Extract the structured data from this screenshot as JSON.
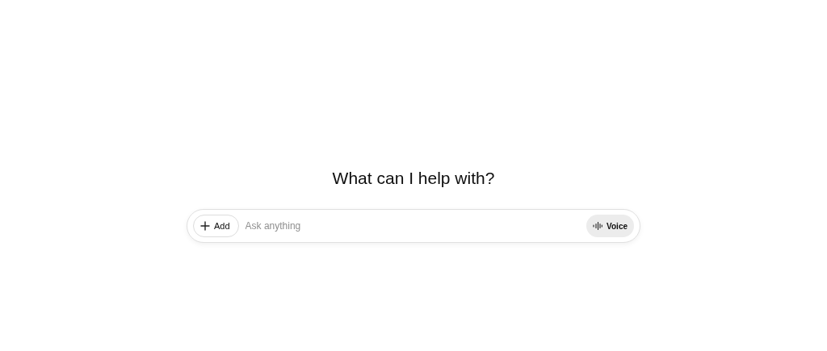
{
  "heading": "What can I help with?",
  "composer": {
    "add_button": "Add",
    "placeholder": "Ask anything",
    "voice_button": "Voice"
  }
}
